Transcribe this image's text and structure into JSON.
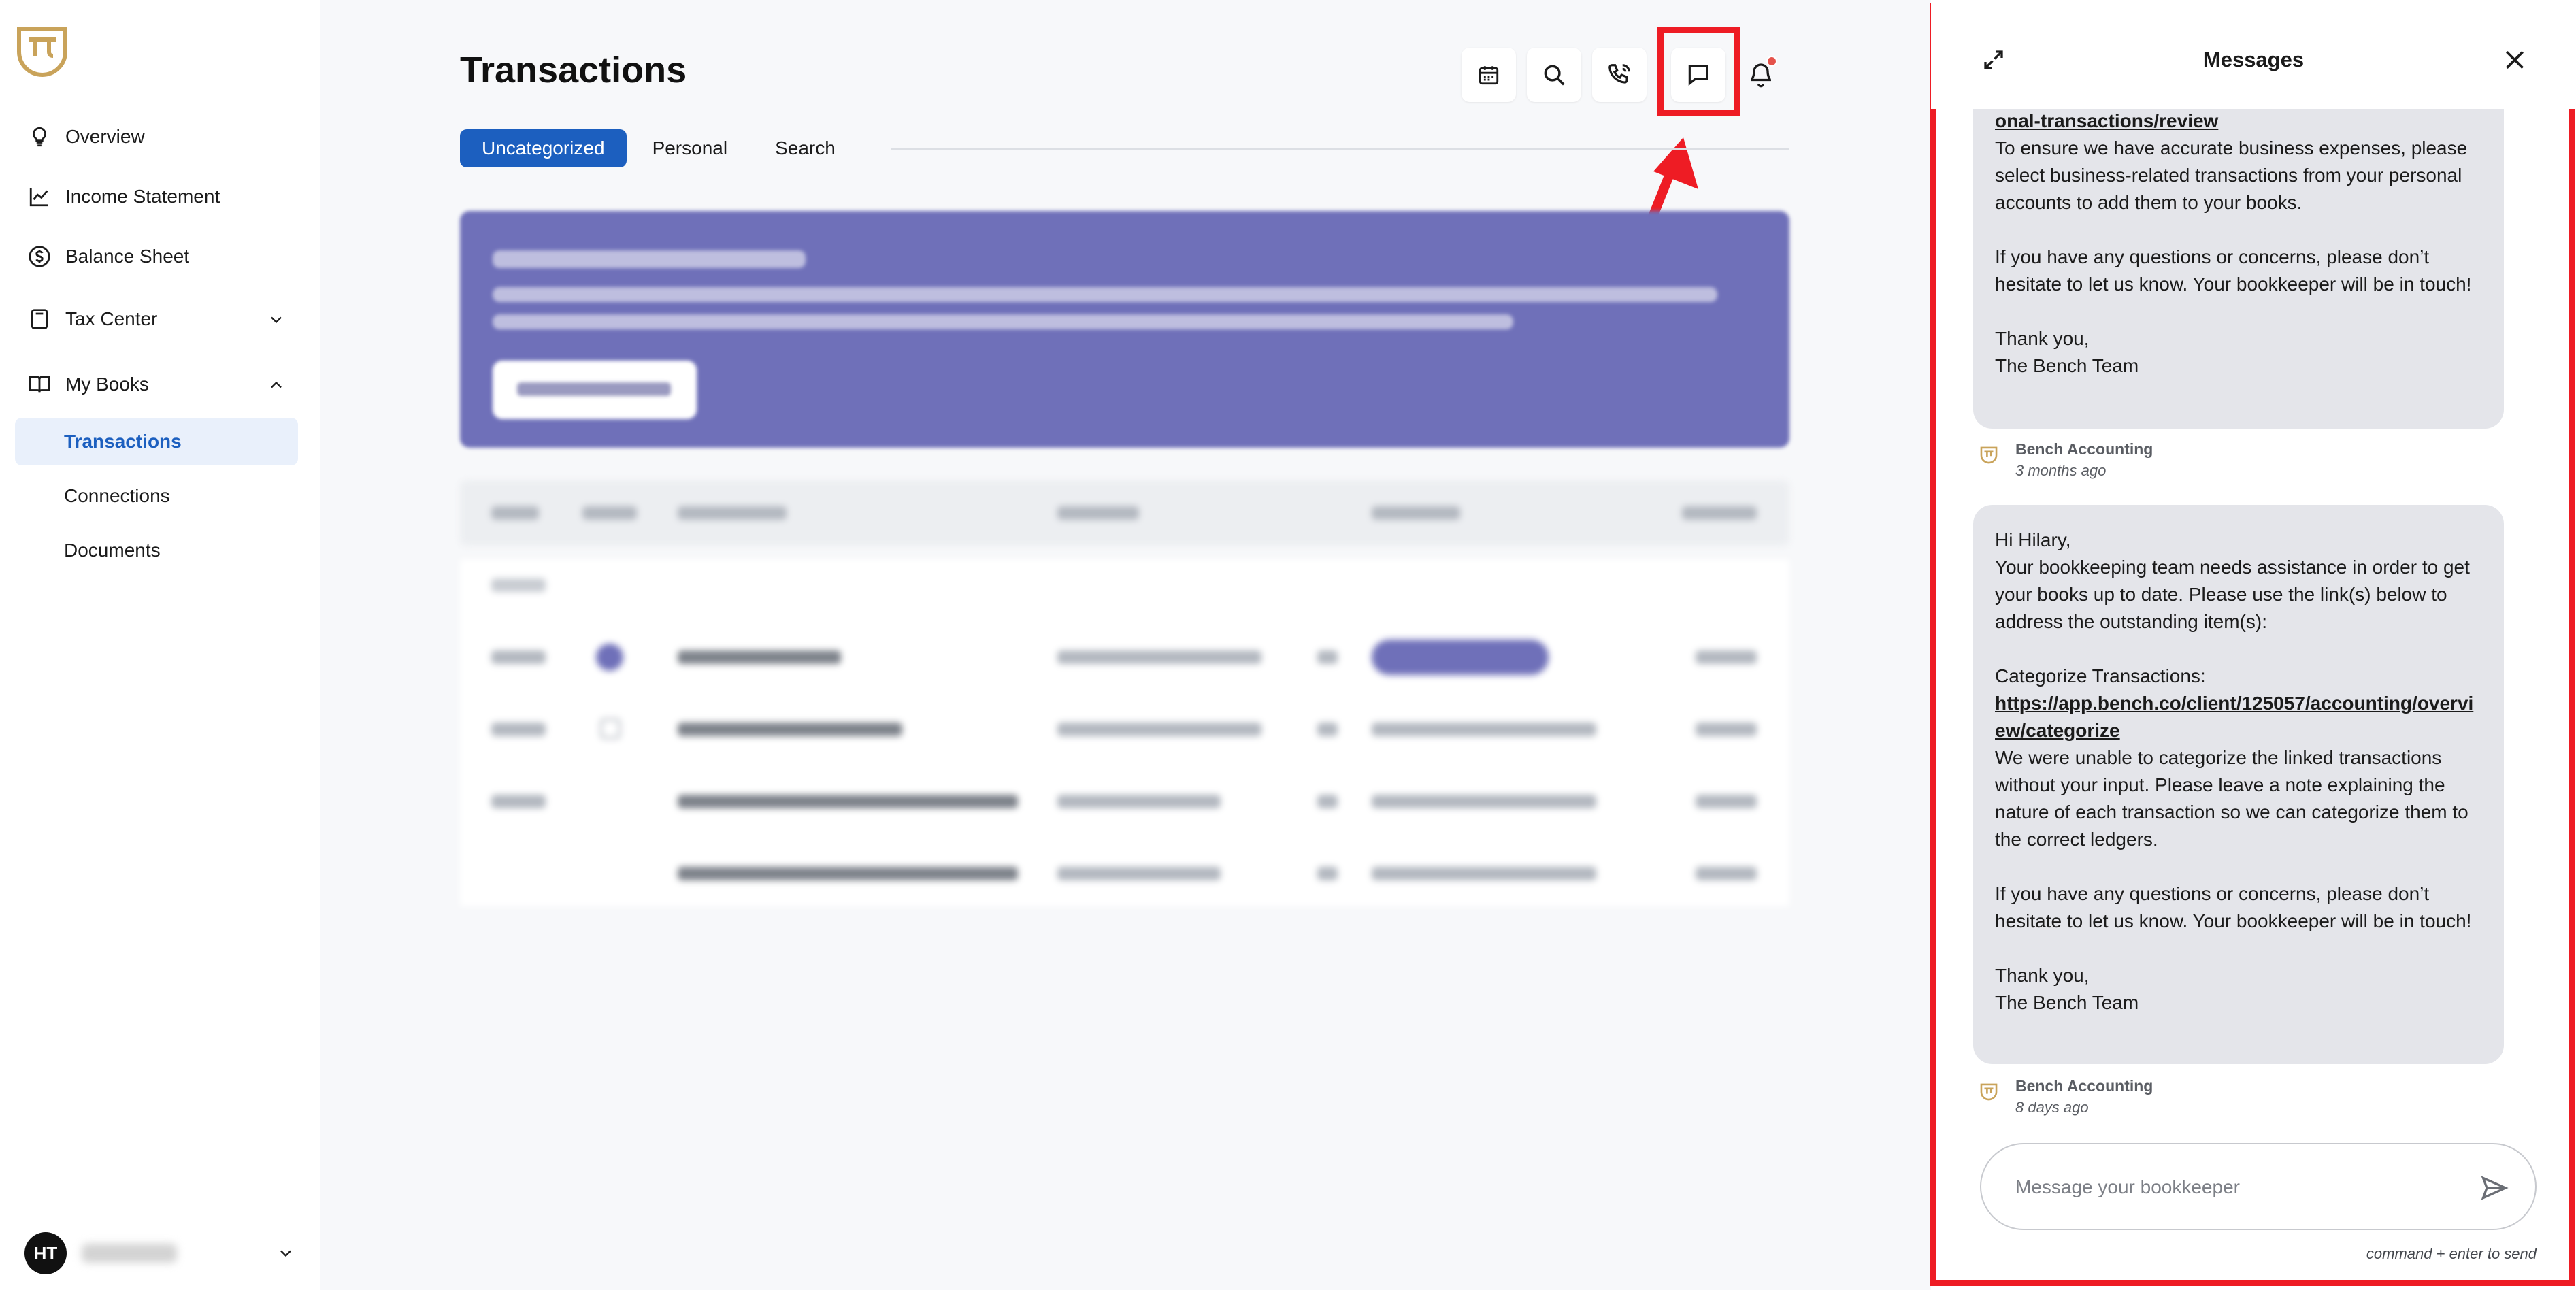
{
  "colors": {
    "accent": "#1c5fbf",
    "brand_gold": "#c9a35a",
    "highlight_red": "#ee1c24",
    "banner": "#6f70b9"
  },
  "sidebar": {
    "logo": "bench-logo-icon",
    "items": [
      {
        "label": "Overview",
        "icon": "lightbulb-icon"
      },
      {
        "label": "Income Statement",
        "icon": "line-chart-icon"
      },
      {
        "label": "Balance Sheet",
        "icon": "dollar-circle-icon"
      },
      {
        "label": "Tax Center",
        "icon": "calculator-icon"
      },
      {
        "label": "My Books",
        "icon": "book-icon"
      }
    ],
    "sub_items": [
      {
        "label": "Transactions",
        "active": true
      },
      {
        "label": "Connections"
      },
      {
        "label": "Documents"
      }
    ],
    "user": {
      "initials": "HT"
    }
  },
  "main": {
    "title": "Transactions",
    "toolbar": [
      "calendar-icon",
      "search-icon",
      "phone-icon",
      "chat-icon",
      "bell-icon"
    ],
    "tabs": [
      {
        "label": "Uncategorized",
        "active": true
      },
      {
        "label": "Personal"
      },
      {
        "label": "Search"
      }
    ]
  },
  "messages": {
    "title": "Messages",
    "top_message": {
      "link_tail": "onal-transactions/review",
      "p1": "To ensure we have accurate business expenses, please select business-related transactions from your personal accounts to add them to your books.",
      "p2": "If you have any questions or concerns, please don’t hesitate to let us know. Your bookkeeper will be in touch!",
      "sign1": "Thank you,",
      "sign2": "The Bench Team",
      "sender": "Bench Accounting",
      "time": "3 months ago"
    },
    "bottom_message": {
      "greeting": "Hi Hilary,",
      "intro": "Your bookkeeping team needs assistance in order to get your books up to date. Please use the link(s) below to address the outstanding item(s):",
      "section": "Categorize Transactions:",
      "link": "https://app.bench.co/client/125057/accounting/overview/categorize",
      "body": "We were unable to categorize the linked transactions without your input. Please leave a note explaining the nature of each transaction so we can categorize them to the correct ledgers.",
      "p2": "If you have any questions or concerns, please don’t hesitate to let us know. Your bookkeeper will be in touch!",
      "sign1": "Thank you,",
      "sign2": "The Bench Team",
      "sender": "Bench Accounting",
      "time": "8 days ago"
    },
    "composer": {
      "placeholder": "Message your bookkeeper",
      "hint": "command + enter to send"
    }
  }
}
